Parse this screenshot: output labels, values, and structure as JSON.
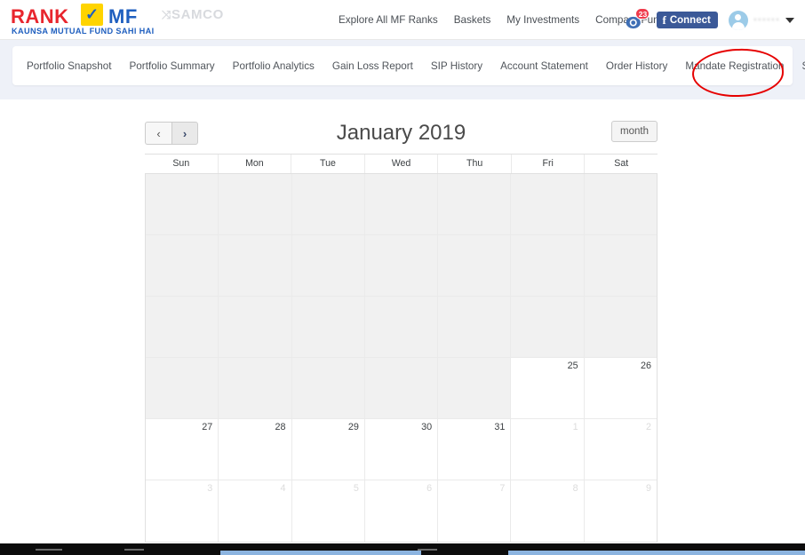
{
  "header": {
    "logo": {
      "rank": "RANK",
      "mf": "MF",
      "check": "✓",
      "tagline": "KAUNSA MUTUAL FUND SAHI HAI",
      "partner": "SAMCO",
      "partner_mark": "⤨"
    },
    "nav": [
      {
        "label": "Explore All MF Ranks"
      },
      {
        "label": "Baskets"
      },
      {
        "label": "My Investments"
      },
      {
        "label": "Compare Funds"
      }
    ],
    "notifications": {
      "count": "23",
      "icon": "notification-bell-icon"
    },
    "facebook": {
      "label": "Connect",
      "mark": "f",
      "color": "#3b5998"
    },
    "account": {
      "name": "••••••",
      "avatar": "user-avatar-icon",
      "chevron": "▾"
    }
  },
  "tabs": [
    {
      "label": "Portfolio Snapshot",
      "active": false
    },
    {
      "label": "Portfolio Summary",
      "active": false
    },
    {
      "label": "Portfolio Analytics",
      "active": false
    },
    {
      "label": "Gain Loss Report",
      "active": false
    },
    {
      "label": "SIP History",
      "active": false
    },
    {
      "label": "Account Statement",
      "active": false
    },
    {
      "label": "Order History",
      "active": false
    },
    {
      "label": "Mandate Registration",
      "active": false
    },
    {
      "label": "SIP Calendar",
      "active": true
    }
  ],
  "annotation": {
    "shape": "ellipse",
    "color": "#e60000",
    "target": "SIP Calendar"
  },
  "calendar": {
    "title": "January 2019",
    "prev_label": "‹",
    "next_label": "›",
    "view_label": "month",
    "weekdays": [
      "Sun",
      "Mon",
      "Tue",
      "Wed",
      "Thu",
      "Fri",
      "Sat"
    ],
    "weeks": [
      [
        {
          "day": "",
          "state": "blank"
        },
        {
          "day": "",
          "state": "blank"
        },
        {
          "day": "",
          "state": "blank"
        },
        {
          "day": "",
          "state": "blank"
        },
        {
          "day": "",
          "state": "blank"
        },
        {
          "day": "",
          "state": "blank"
        },
        {
          "day": "",
          "state": "blank"
        }
      ],
      [
        {
          "day": "",
          "state": "blank"
        },
        {
          "day": "",
          "state": "blank"
        },
        {
          "day": "",
          "state": "blank"
        },
        {
          "day": "",
          "state": "blank"
        },
        {
          "day": "",
          "state": "blank"
        },
        {
          "day": "",
          "state": "blank"
        },
        {
          "day": "",
          "state": "blank"
        }
      ],
      [
        {
          "day": "",
          "state": "blank"
        },
        {
          "day": "",
          "state": "blank"
        },
        {
          "day": "",
          "state": "blank"
        },
        {
          "day": "",
          "state": "blank"
        },
        {
          "day": "",
          "state": "blank"
        },
        {
          "day": "",
          "state": "blank"
        },
        {
          "day": "",
          "state": "blank"
        }
      ],
      [
        {
          "day": "",
          "state": "blank"
        },
        {
          "day": "",
          "state": "blank"
        },
        {
          "day": "",
          "state": "blank"
        },
        {
          "day": "",
          "state": "blank"
        },
        {
          "day": "",
          "state": "blank"
        },
        {
          "day": "25",
          "state": "current"
        },
        {
          "day": "26",
          "state": "current"
        }
      ],
      [
        {
          "day": "27",
          "state": "current"
        },
        {
          "day": "28",
          "state": "current"
        },
        {
          "day": "29",
          "state": "current"
        },
        {
          "day": "30",
          "state": "current"
        },
        {
          "day": "31",
          "state": "current"
        },
        {
          "day": "1",
          "state": "other"
        },
        {
          "day": "2",
          "state": "other"
        }
      ],
      [
        {
          "day": "3",
          "state": "other"
        },
        {
          "day": "4",
          "state": "other"
        },
        {
          "day": "5",
          "state": "other"
        },
        {
          "day": "6",
          "state": "other"
        },
        {
          "day": "7",
          "state": "other"
        },
        {
          "day": "8",
          "state": "other"
        },
        {
          "day": "9",
          "state": "other"
        }
      ]
    ]
  }
}
